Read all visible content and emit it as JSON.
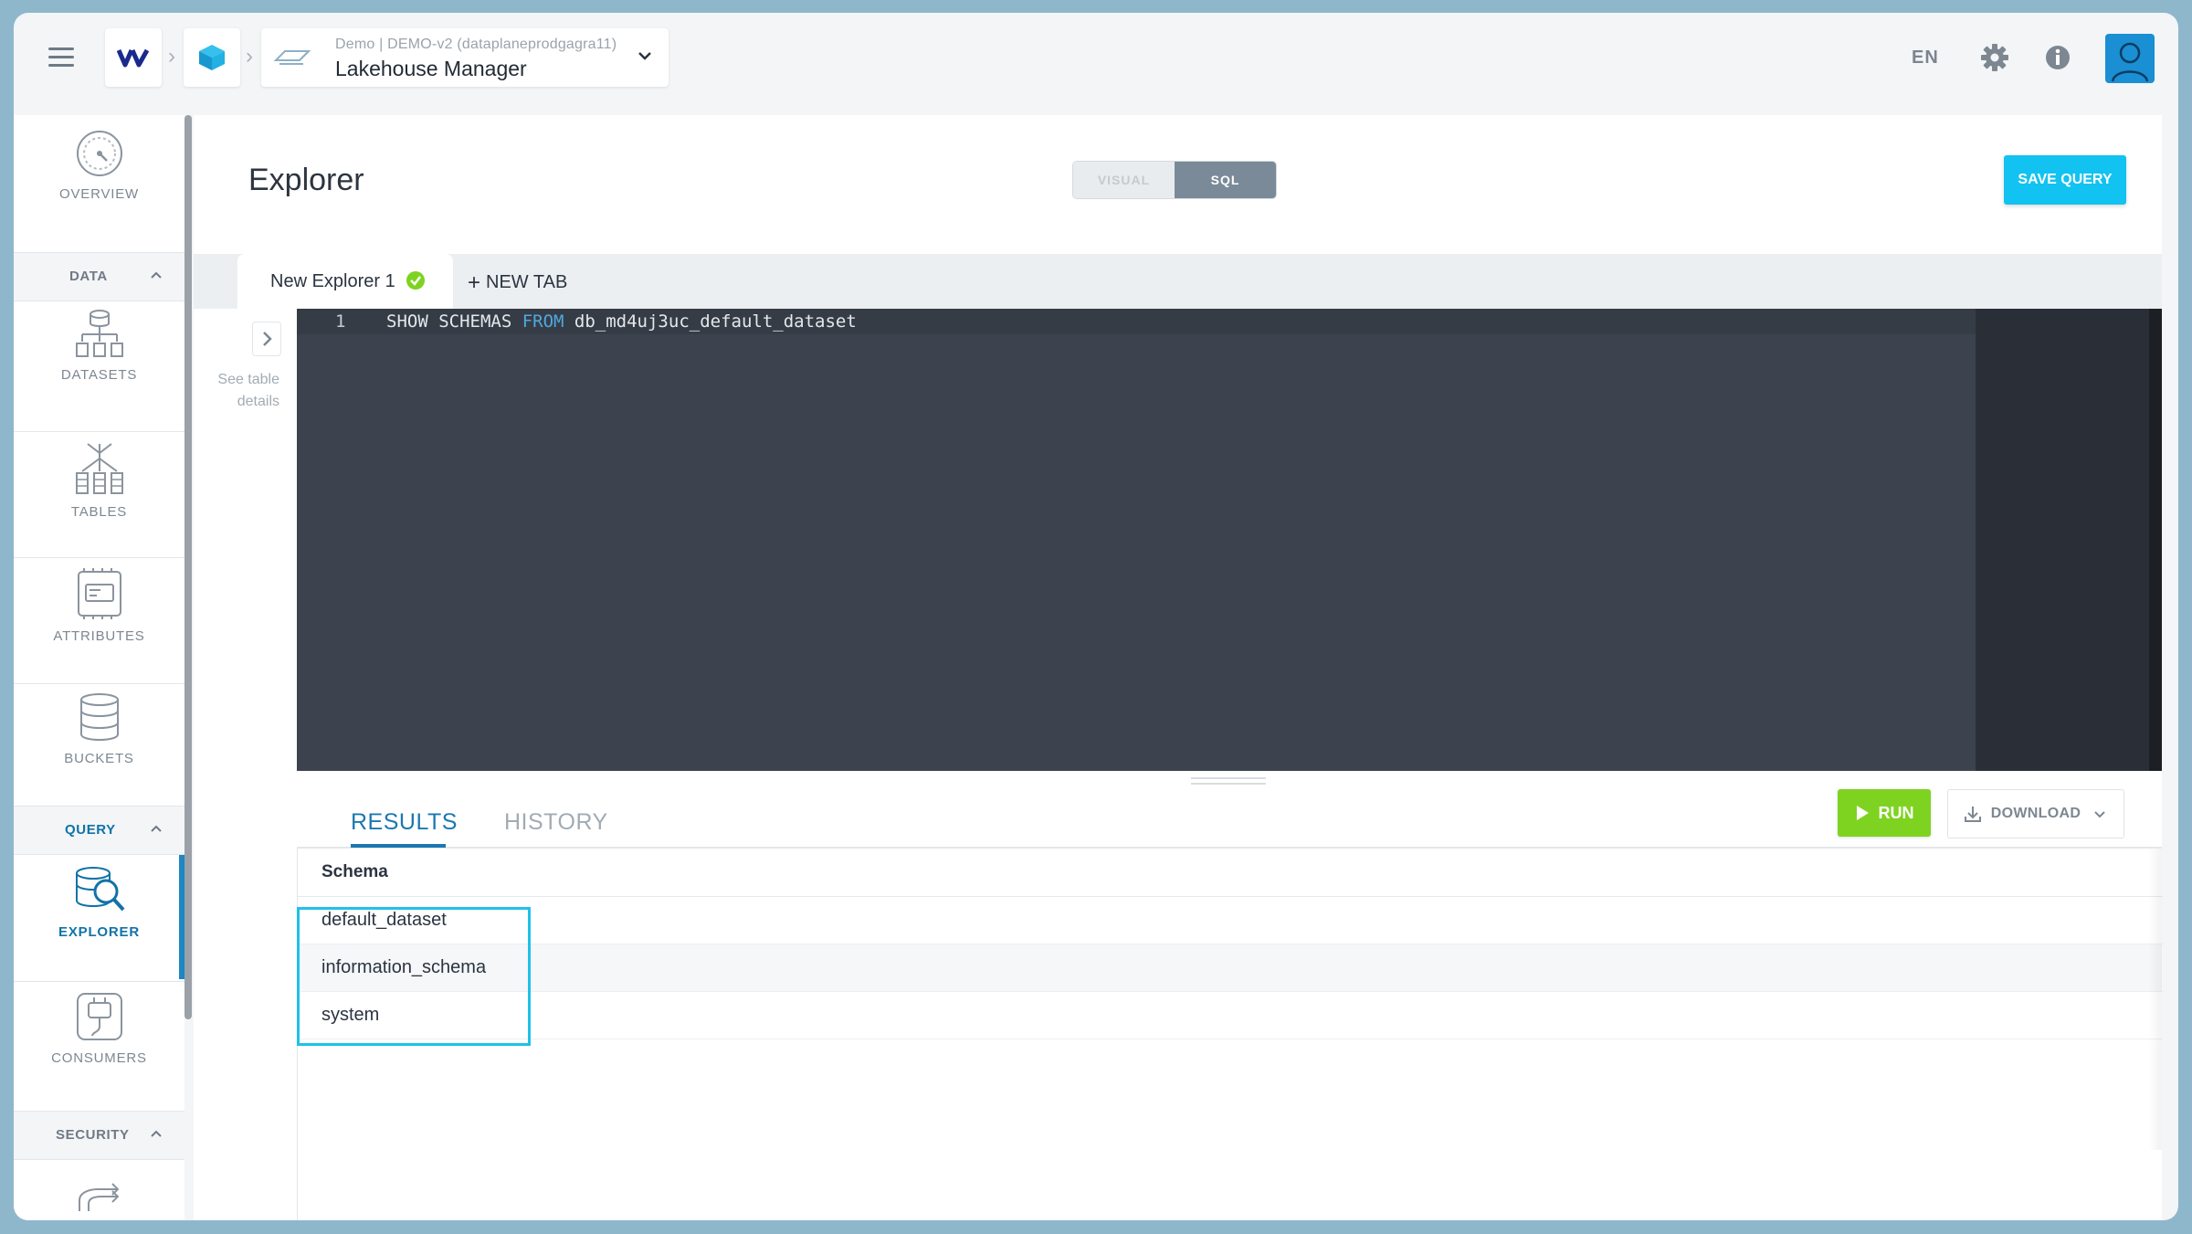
{
  "topbar": {
    "workspace_sub": "Demo | DEMO-v2 (dataplaneprodgagra11)",
    "app_title": "Lakehouse Manager",
    "language": "EN"
  },
  "sidebar": {
    "overview": "OVERVIEW",
    "data_section": "DATA",
    "datasets": "DATASETS",
    "tables": "TABLES",
    "attributes": "ATTRIBUTES",
    "buckets": "BUCKETS",
    "query_section": "QUERY",
    "explorer": "EXPLORER",
    "consumers": "CONSUMERS",
    "security_section": "SECURITY"
  },
  "main": {
    "title": "Explorer",
    "toggle": {
      "visual": "VISUAL",
      "sql": "SQL",
      "selected": "SQL"
    },
    "save_query": "SAVE QUERY",
    "tabs": [
      {
        "label": "New Explorer 1",
        "status": "saved"
      }
    ],
    "new_tab": "NEW TAB",
    "see_table_details": "See table details",
    "editor": {
      "line_number": "1",
      "code_before_kw": "SHOW SCHEMAS ",
      "code_kw": "FROM",
      "code_after_kw": " db_md4uj3uc_default_dataset"
    },
    "run": "RUN",
    "download": "DOWNLOAD",
    "result_tabs": {
      "results": "RESULTS",
      "history": "HISTORY",
      "active": "RESULTS"
    },
    "results": {
      "column": "Schema",
      "rows": [
        "default_dataset",
        "information_schema",
        "system"
      ]
    }
  },
  "colors": {
    "accent": "#12c2f0",
    "run_green": "#7ed321",
    "active_blue": "#1c78b0",
    "highlight": "#1ec1ea",
    "editor_bg": "#3d434e"
  }
}
